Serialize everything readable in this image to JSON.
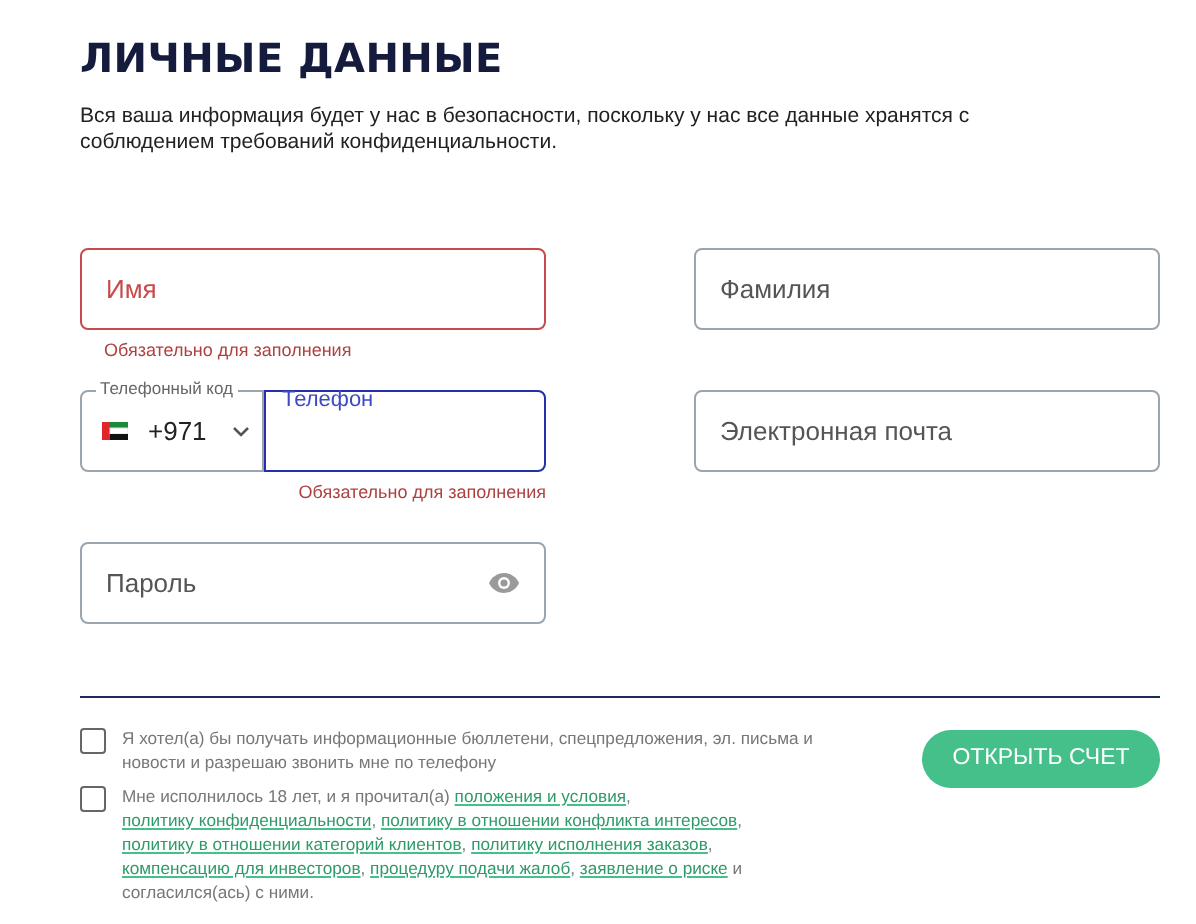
{
  "heading": "ЛИЧНЫЕ ДАННЫЕ",
  "intro": "Вся ваша информация будет у нас в безопасности, поскольку у нас все данные хранятся с соблюдением требований конфиденциальности.",
  "fields": {
    "first_name": {
      "placeholder": "Имя",
      "error": "Обязательно для заполнения",
      "invalid": true
    },
    "last_name": {
      "placeholder": "Фамилия",
      "invalid": false
    },
    "phone_code": {
      "label": "Телефонный код",
      "value": "+971"
    },
    "phone": {
      "label": "Телефон",
      "focused": true,
      "error": "Обязательно для заполнения"
    },
    "email": {
      "placeholder": "Электронная почта",
      "invalid": false
    },
    "password": {
      "placeholder": "Пароль"
    }
  },
  "consents": [
    {
      "checked": false,
      "segments": [
        {
          "kind": "text",
          "text": "Я хотел(а) бы получать информационные бюллетени, спецпредложения, эл. письма и новости и разрешаю звонить мне по телефону"
        }
      ]
    },
    {
      "checked": false,
      "segments": [
        {
          "kind": "text",
          "text": "Мне исполнилось 18 лет, и я прочитал(а)"
        },
        {
          "kind": "link",
          "text": "положения и условия"
        },
        {
          "kind": "text",
          "text": ","
        },
        {
          "kind": "link",
          "text": "политику конфиденциальности"
        },
        {
          "kind": "text",
          "text": ","
        },
        {
          "kind": "link",
          "text": "политику в отношении конфликта интересов"
        },
        {
          "kind": "text",
          "text": ","
        },
        {
          "kind": "link",
          "text": "политику в отношении категорий клиентов"
        },
        {
          "kind": "text",
          "text": ","
        },
        {
          "kind": "link",
          "text": "политику исполнения заказов"
        },
        {
          "kind": "text",
          "text": ","
        },
        {
          "kind": "link",
          "text": "компенсацию для инвесторов"
        },
        {
          "kind": "text",
          "text": ","
        },
        {
          "kind": "link",
          "text": "процедуру подачи жалоб"
        },
        {
          "kind": "text",
          "text": ","
        },
        {
          "kind": "link",
          "text": "заявление о риске"
        },
        {
          "kind": "text",
          "text": "и согласился(ась) с ними."
        }
      ]
    }
  ],
  "submit": "ОТКРЫТЬ СЧЕТ"
}
